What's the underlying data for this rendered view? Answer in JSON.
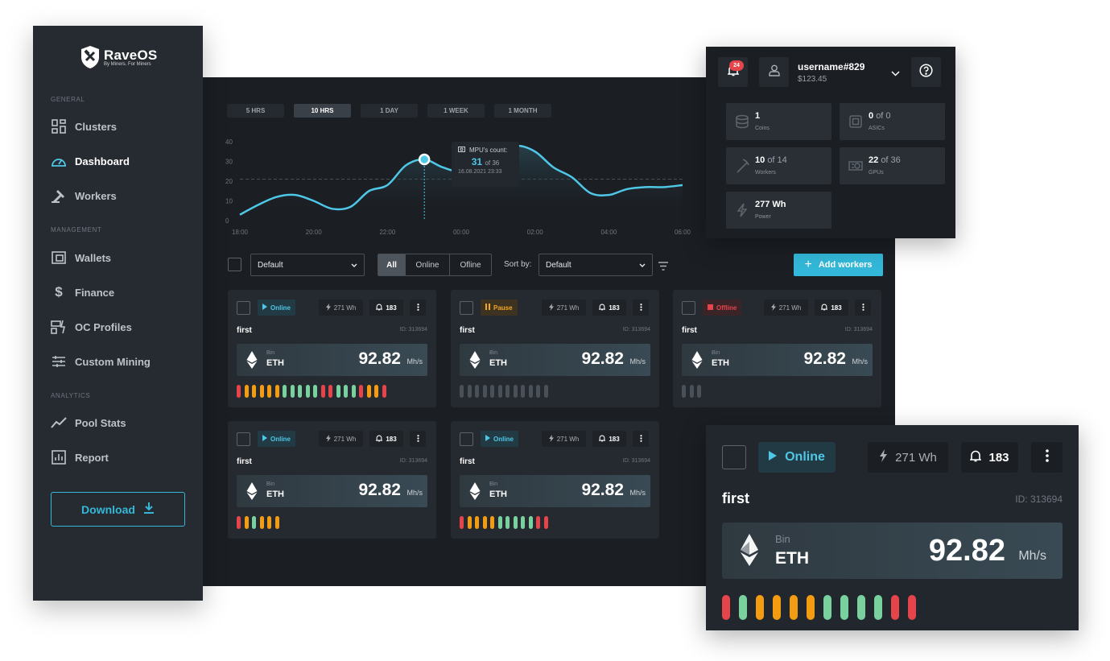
{
  "brand": {
    "name": "RaveOS",
    "tagline": "By Miners. For Miners"
  },
  "sidebar": {
    "sections": [
      {
        "label": "GENERAL"
      },
      {
        "label": "MANAGEMENT"
      },
      {
        "label": "ANALYTICS"
      }
    ],
    "items": [
      {
        "label": "Clusters",
        "icon": "clusters-icon"
      },
      {
        "label": "Dashboard",
        "icon": "dashboard-icon",
        "active": true
      },
      {
        "label": "Workers",
        "icon": "workers-icon"
      },
      {
        "label": "Wallets",
        "icon": "wallet-icon"
      },
      {
        "label": "Finance",
        "icon": "dollar-icon"
      },
      {
        "label": "OC Profiles",
        "icon": "oc-profiles-icon"
      },
      {
        "label": "Custom Mining",
        "icon": "sliders-icon"
      },
      {
        "label": "Pool Stats",
        "icon": "trend-icon"
      },
      {
        "label": "Report",
        "icon": "report-icon"
      }
    ],
    "download_label": "Download"
  },
  "range_tabs": [
    {
      "label": "5 HRS"
    },
    {
      "label": "10 HRS",
      "active": true
    },
    {
      "label": "1 DAY"
    },
    {
      "label": "1 WEEK"
    },
    {
      "label": "1 MONTH"
    }
  ],
  "chart_data": {
    "type": "area",
    "x_ticks": [
      "18:00",
      "20:00",
      "22:00",
      "00:00",
      "02:00",
      "04:00",
      "06:00"
    ],
    "y_ticks": [
      0,
      10,
      20,
      30,
      40
    ],
    "ylim": [
      0,
      40
    ],
    "x": [
      0,
      0.5,
      1,
      1.5,
      2,
      2.5,
      3,
      3.5,
      4,
      4.5,
      5,
      5.5,
      6,
      6.5,
      7,
      7.5,
      8,
      8.5,
      9,
      9.5,
      10,
      10.5,
      11,
      11.5,
      12
    ],
    "values": [
      3,
      8,
      12,
      13,
      10,
      6,
      7,
      15,
      18,
      28,
      31,
      27,
      25,
      30,
      35,
      38,
      35,
      27,
      22,
      14,
      13,
      16,
      17,
      17,
      18
    ],
    "reference_line": 21,
    "line_color": "#4fc7e6",
    "tooltip": {
      "label": "MPU's count:",
      "value": "31",
      "total": "of 36",
      "date": "16.08.2021 23:33",
      "x": 5
    }
  },
  "filters": {
    "group_select": "Default",
    "segments": [
      {
        "label": "All",
        "active": true
      },
      {
        "label": "Online"
      },
      {
        "label": "Ofline"
      }
    ],
    "sort_label": "Sort by:",
    "sort_select": "Default",
    "add_workers_label": "Add workers"
  },
  "cards": [
    {
      "status": "Online",
      "status_type": "online",
      "watt": "271 Wh",
      "alerts": "183",
      "name": "first",
      "id": "ID: 313694",
      "coin_sub": "Bin",
      "coin": "ETH",
      "rate": "92.82",
      "unit": "Mh/s",
      "bars": [
        "#e5444b",
        "#f39c12",
        "#f39c12",
        "#f39c12",
        "#f39c12",
        "#f39c12",
        "#79d29e",
        "#79d29e",
        "#79d29e",
        "#79d29e",
        "#79d29e",
        "#e5444b",
        "#e5444b",
        "#79d29e",
        "#79d29e",
        "#79d29e",
        "#e5444b",
        "#f39c12",
        "#f39c12",
        "#e5444b"
      ]
    },
    {
      "status": "Pause",
      "status_type": "pause",
      "watt": "271 Wh",
      "alerts": "183",
      "name": "first",
      "id": "ID: 313694",
      "coin_sub": "Bin",
      "coin": "ETH",
      "rate": "92.82",
      "unit": "Mh/s",
      "bars": [
        "#4a5058",
        "#4a5058",
        "#4a5058",
        "#4a5058",
        "#4a5058",
        "#4a5058",
        "#4a5058",
        "#4a5058",
        "#4a5058",
        "#4a5058",
        "#4a5058",
        "#4a5058"
      ]
    },
    {
      "status": "Offline",
      "status_type": "offline",
      "watt": "271 Wh",
      "alerts": "183",
      "name": "first",
      "id": "ID: 313694",
      "coin_sub": "Bin",
      "coin": "ETH",
      "rate": "92.82",
      "unit": "Mh/s",
      "bars": [
        "#4a5058",
        "#4a5058",
        "#4a5058"
      ]
    },
    {
      "status": "Online",
      "status_type": "online",
      "watt": "271 Wh",
      "alerts": "183",
      "name": "first",
      "id": "ID: 313694",
      "coin_sub": "Bin",
      "coin": "ETH",
      "rate": "92.82",
      "unit": "Mh/s",
      "bars": [
        "#e5444b",
        "#f39c12",
        "#79d29e",
        "#f39c12",
        "#f39c12",
        "#f39c12"
      ]
    },
    {
      "status": "Online",
      "status_type": "online",
      "watt": "271 Wh",
      "alerts": "183",
      "name": "first",
      "id": "ID: 313694",
      "coin_sub": "Bin",
      "coin": "ETH",
      "rate": "92.82",
      "unit": "Mh/s",
      "bars": [
        "#e5444b",
        "#f39c12",
        "#f39c12",
        "#f39c12",
        "#f39c12",
        "#79d29e",
        "#79d29e",
        "#79d29e",
        "#79d29e",
        "#79d29e",
        "#e5444b",
        "#e5444b"
      ]
    }
  ],
  "user_panel": {
    "notifications": "24",
    "username": "username#829",
    "balance": "$123.45",
    "stats": [
      {
        "value": "1",
        "of": "",
        "label": "Coins",
        "icon": "coins-icon"
      },
      {
        "value": "0",
        "of": "of 0",
        "label": "ASICs",
        "icon": "asic-icon"
      },
      {
        "value": "10",
        "of": "of 14",
        "label": "Workers",
        "icon": "pickaxe-icon"
      },
      {
        "value": "22",
        "of": "of 36",
        "label": "GPUs",
        "icon": "gpu-icon"
      },
      {
        "value": "277 Wh",
        "of": "",
        "label": "Power",
        "icon": "lightning-icon"
      }
    ]
  },
  "big_card": {
    "status": "Online",
    "watt": "271 Wh",
    "alerts": "183",
    "name": "first",
    "id": "ID: 313694",
    "coin_sub": "Bin",
    "coin": "ETH",
    "rate": "92.82",
    "unit": "Mh/s",
    "bars": [
      "#e5444b",
      "#79d29e",
      "#f39c12",
      "#f39c12",
      "#f39c12",
      "#f39c12",
      "#79d29e",
      "#79d29e",
      "#79d29e",
      "#79d29e",
      "#e5444b",
      "#e5444b"
    ]
  }
}
